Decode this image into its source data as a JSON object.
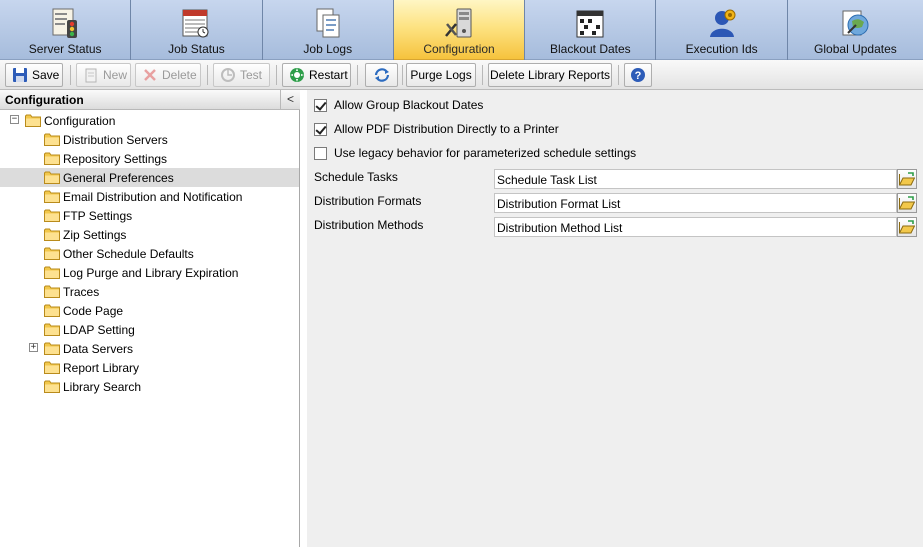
{
  "tabs": [
    {
      "label": "Server Status",
      "icon": "server-status-icon"
    },
    {
      "label": "Job Status",
      "icon": "job-status-icon"
    },
    {
      "label": "Job Logs",
      "icon": "job-logs-icon"
    },
    {
      "label": "Configuration",
      "icon": "configuration-icon",
      "active": true
    },
    {
      "label": "Blackout Dates",
      "icon": "calendar-icon"
    },
    {
      "label": "Execution Ids",
      "icon": "execution-ids-icon"
    },
    {
      "label": "Global Updates",
      "icon": "global-updates-icon"
    }
  ],
  "toolbar": {
    "save": "Save",
    "new": "New",
    "delete": "Delete",
    "test": "Test",
    "restart": "Restart",
    "purge_logs": "Purge Logs",
    "delete_library_reports": "Delete Library Reports"
  },
  "left_panel": {
    "title": "Configuration",
    "collapse": "<",
    "tree": {
      "root": "Configuration",
      "items": [
        "Distribution Servers",
        "Repository Settings",
        "General Preferences",
        "Email Distribution and Notification",
        "FTP Settings",
        "Zip Settings",
        "Other Schedule Defaults",
        "Log Purge and Library Expiration",
        "Traces",
        "Code Page",
        "LDAP Setting",
        "Data Servers",
        "Report Library",
        "Library Search"
      ],
      "selected": "General Preferences"
    }
  },
  "preferences": {
    "checkboxes": [
      {
        "label": "Allow Group Blackout Dates",
        "checked": true
      },
      {
        "label": "Allow PDF Distribution Directly to a Printer",
        "checked": true
      },
      {
        "label": "Use legacy behavior for parameterized schedule settings",
        "checked": false
      }
    ],
    "fields": [
      {
        "label": "Schedule Tasks",
        "value": "Schedule Task List"
      },
      {
        "label": "Distribution Formats",
        "value": "Distribution Format List"
      },
      {
        "label": "Distribution Methods",
        "value": "Distribution Method List"
      }
    ]
  },
  "colors": {
    "active_tab": "#f6c33d",
    "inactive_tab": "#b3c6e4",
    "folder": "#f2c84b",
    "selected_row": "#dcdcdc"
  }
}
